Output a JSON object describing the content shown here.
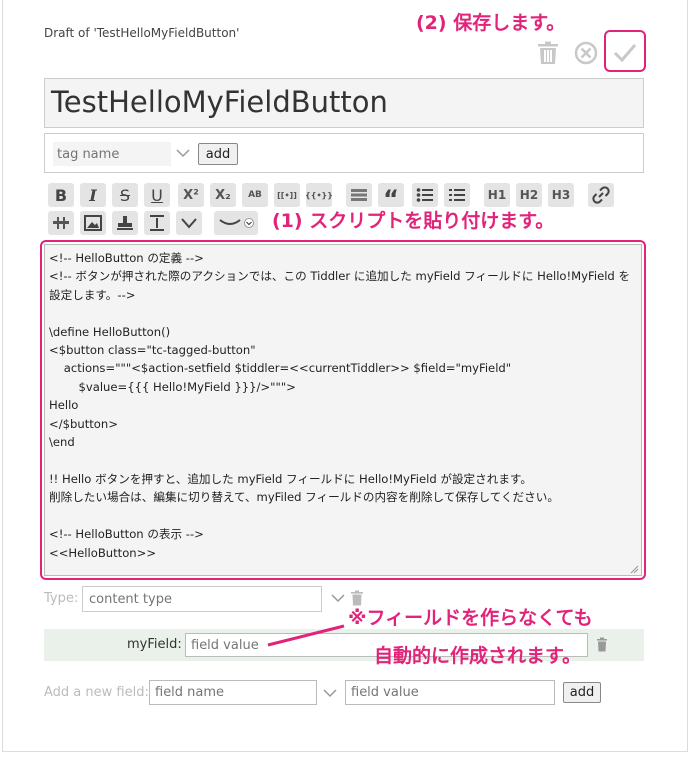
{
  "header": {
    "draft_label": "Draft of 'TestHelloMyFieldButton'"
  },
  "annotations": {
    "save": "(2) 保存します。",
    "script": "(1) スクリプトを貼り付けます。",
    "field_line1": "※フィールドを作らなくても",
    "field_line2": "自動的に作成されます。"
  },
  "controls": {
    "delete_icon": "trash-icon",
    "cancel_icon": "cancel-icon",
    "done_icon": "checkmark-icon"
  },
  "title": {
    "value": "TestHelloMyFieldButton"
  },
  "tags": {
    "placeholder": "tag name",
    "add_label": "add"
  },
  "toolbar": {
    "superscript": "X²",
    "subscript": "X₂",
    "smallcaps": "AB",
    "link": "[[•]]",
    "transclude": "{{•}}",
    "h1": "H1",
    "h2": "H2",
    "h3": "H3"
  },
  "editor": {
    "text": "<!-- HelloButton の定義 -->\n<!-- ボタンが押された際のアクションでは、この Tiddler に追加した myField フィールドに Hello!MyField を設定します。-->\n\n\\define HelloButton()\n<$button class=\"tc-tagged-button\"\n    actions=\"\"\"<$action-setfield $tiddler=<<currentTiddler>> $field=\"myField\"\n        $value={{{ Hello!MyField }}}/>\"\"\">\nHello\n</$button>\n\\end\n\n!! Hello ボタンを押すと、追加した myField フィールドに Hello!MyField が設定されます。\n削除したい場合は、編集に切り替えて、myFiled フィールドの内容を削除して保存してください。\n\n<!-- HelloButton の表示 -->\n<<HelloButton>>"
  },
  "type": {
    "label": "Type:",
    "placeholder": "content type"
  },
  "fields": [
    {
      "name": "myField:",
      "value_placeholder": "field value"
    }
  ],
  "new_field": {
    "label": "Add a new field:",
    "name_placeholder": "field name",
    "value_placeholder": "field value",
    "add_label": "add"
  },
  "colors": {
    "accent": "#e2237a"
  }
}
